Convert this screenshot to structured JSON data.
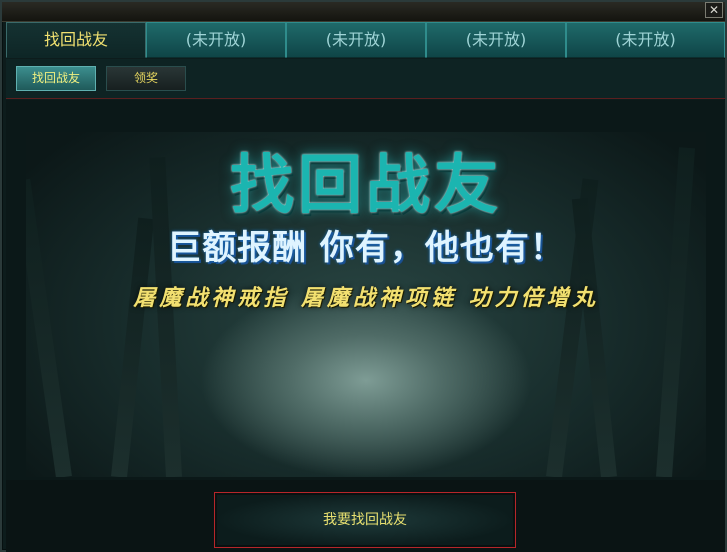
{
  "window": {
    "close_glyph": "✕"
  },
  "tabs": [
    {
      "label": "找回战友"
    },
    {
      "label": "(未开放)"
    },
    {
      "label": "(未开放)"
    },
    {
      "label": "(未开放)"
    },
    {
      "label": "(未开放)"
    }
  ],
  "subtabs": [
    {
      "label": "找回战友"
    },
    {
      "label": "领奖"
    }
  ],
  "banner": {
    "title": "找回战友",
    "subtitle": "巨额报酬 你有，他也有！",
    "rewards": "屠魔战神戒指 屠魔战神项链 功力倍增丸"
  },
  "footer": {
    "button_label": "我要找回战友"
  },
  "colors": {
    "accent_yellow": "#f0e070",
    "tab_teal": "#1f6a6a",
    "button_border": "#b7262a"
  }
}
